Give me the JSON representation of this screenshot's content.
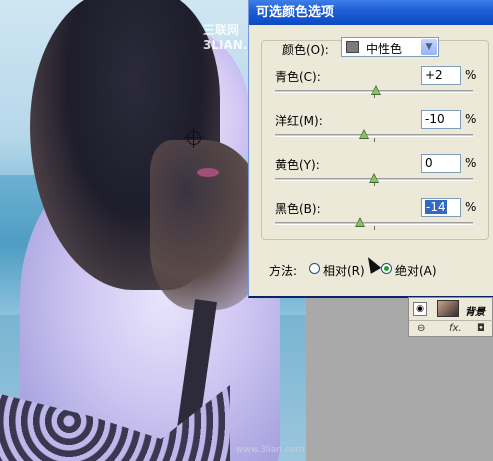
{
  "photo": {
    "watermark": "三联网 3LIAN.COM",
    "site_mark": "www.3lian.com"
  },
  "dialog": {
    "title": "可选颜色选项",
    "colors_label": "颜色(O):",
    "colors_value": "中性色",
    "swatch_color": "#7b7b7b",
    "sliders": [
      {
        "label": "青色(C):",
        "value": "+2",
        "unit": "%",
        "level": 2
      },
      {
        "label": "洋红(M):",
        "value": "-10",
        "unit": "%",
        "level": -10
      },
      {
        "label": "黄色(Y):",
        "value": "0",
        "unit": "%",
        "level": 0
      },
      {
        "label": "黑色(B):",
        "value": "-14",
        "unit": "%",
        "level": -14
      }
    ],
    "method": {
      "label": "方法:",
      "options": [
        {
          "label": "相对(R)",
          "selected": false
        },
        {
          "label": "绝对(A)",
          "selected": true
        }
      ]
    }
  },
  "layers": {
    "layer_name": "背景",
    "eye_icon": "eye-icon",
    "link_icon": "link-icon",
    "fx_label": "fx."
  },
  "colors": {
    "titlebar": "#0b4ac4",
    "dialog_bg": "#ece9d8",
    "selected_text_bg": "#316ac5",
    "radio_dot": "#21a121"
  }
}
